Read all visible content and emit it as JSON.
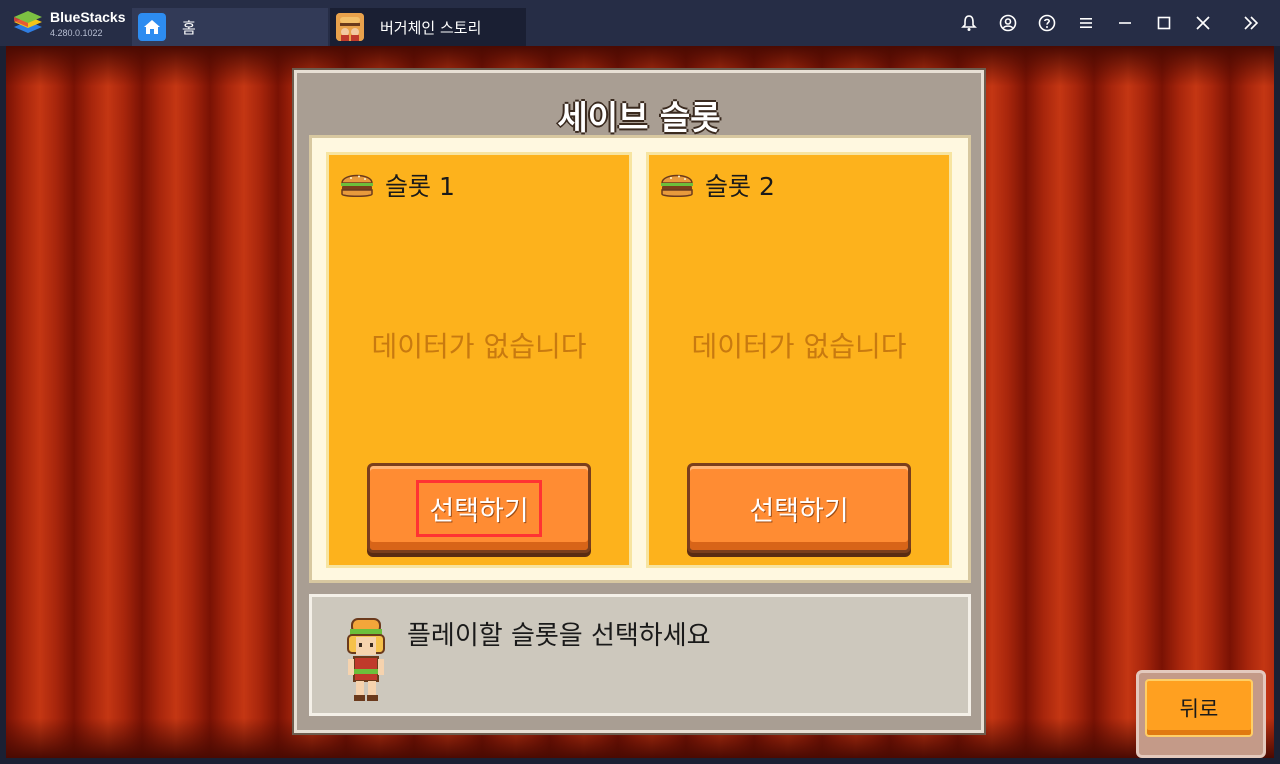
{
  "app": {
    "name": "BlueStacks",
    "version": "4.280.0.1022"
  },
  "tabs": [
    {
      "label": "홈",
      "icon": "home-icon"
    },
    {
      "label": "버거체인 스토리",
      "icon": "game-thumbnail-icon"
    }
  ],
  "titlebar_icons": [
    "bell-icon",
    "account-icon",
    "help-icon",
    "menu-icon",
    "minimize-icon",
    "maximize-icon",
    "close-icon",
    "expand-sidebar-icon"
  ],
  "game": {
    "title": "세이브 슬롯",
    "slots": [
      {
        "label": "슬롯 1",
        "status": "데이터가 없습니다",
        "button": "선택하기",
        "highlighted": true
      },
      {
        "label": "슬롯 2",
        "status": "데이터가 없습니다",
        "button": "선택하기",
        "highlighted": false
      }
    ],
    "message": "플레이할 슬롯을 선택하세요",
    "back_label": "뒤로"
  },
  "colors": {
    "titlebar": "#262d46",
    "slot_bg": "#fdb21c",
    "button": "#ff8c33",
    "highlight": "#ff3333"
  }
}
